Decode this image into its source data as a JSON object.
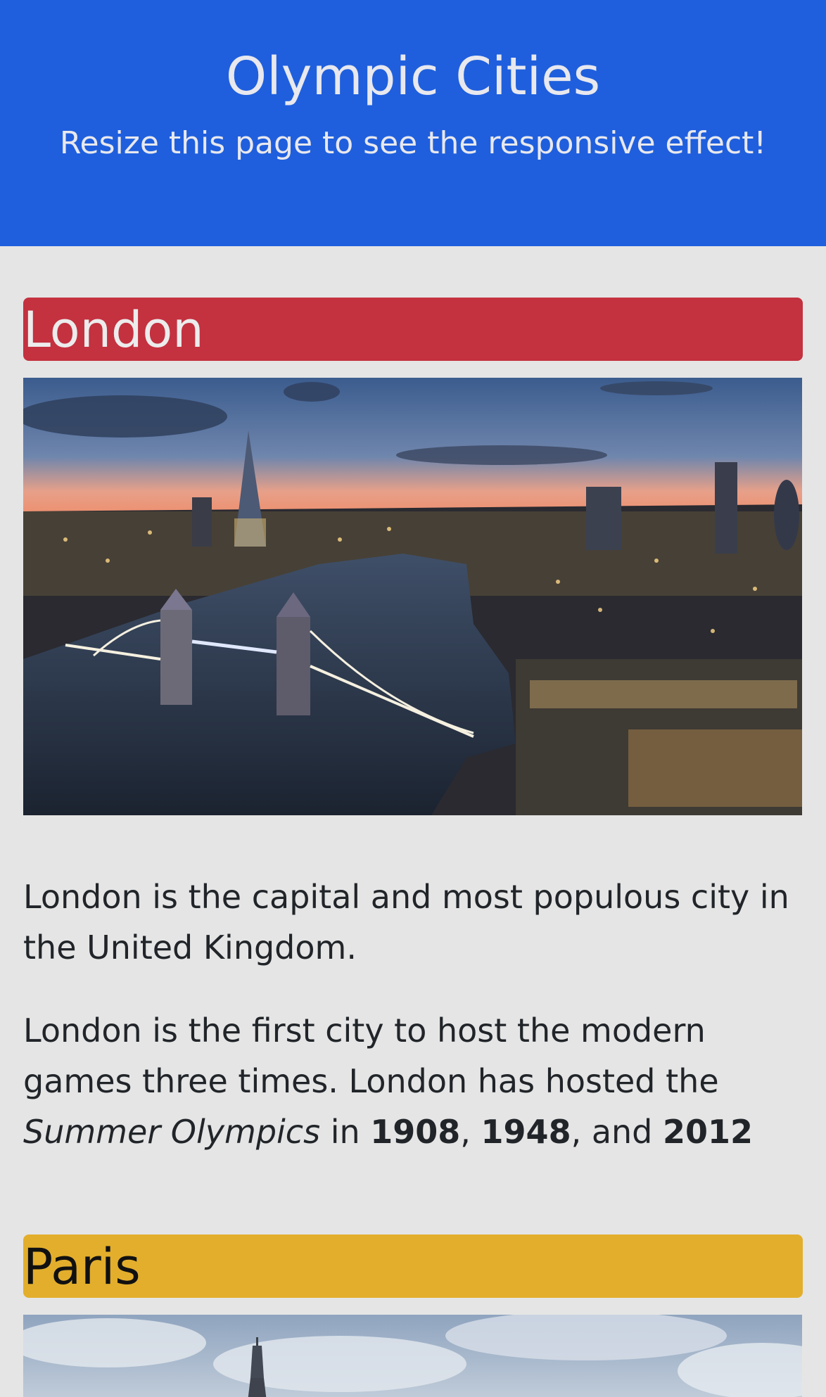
{
  "header": {
    "title": "Olympic Cities",
    "subtitle": "Resize this page to see the responsive effect!"
  },
  "cities": [
    {
      "name": "London",
      "color": "#c4313f",
      "image_icon": "london-skyline-image",
      "p1": "London is the capital and most populous city in the United Kingdom.",
      "p2_intro": "London is the first city to host the modern games three times. London has hosted the ",
      "p2_event": "Summer Olympics",
      "p2_in": " in ",
      "years": [
        "1908",
        "1948",
        "2012"
      ],
      "sep1": ", ",
      "sep2": ", and "
    },
    {
      "name": "Paris",
      "color": "#e3ae2c",
      "image_icon": "paris-eiffel-image"
    }
  ]
}
